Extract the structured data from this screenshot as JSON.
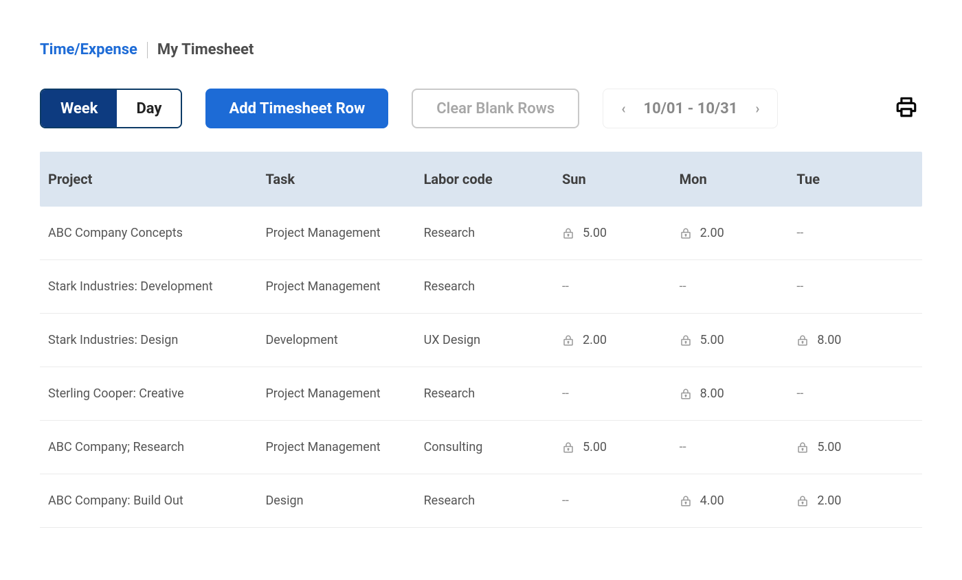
{
  "breadcrumb": {
    "section": "Time/Expense",
    "page": "My Timesheet"
  },
  "toolbar": {
    "view_toggle": {
      "week": "Week",
      "day": "Day",
      "active": "week"
    },
    "add_row": "Add Timesheet Row",
    "clear_rows": "Clear Blank Rows",
    "date_range": "10/01 - 10/31"
  },
  "columns": {
    "project": "Project",
    "task": "Task",
    "labor": "Labor code",
    "sun": "Sun",
    "mon": "Mon",
    "tue": "Tue"
  },
  "rows": [
    {
      "project": "ABC Company Concepts",
      "task": "Project Management",
      "labor": "Research",
      "sun": {
        "locked": true,
        "value": "5.00"
      },
      "mon": {
        "locked": true,
        "value": "2.00"
      },
      "tue": {
        "locked": false,
        "value": "--"
      }
    },
    {
      "project": "Stark Industries: Development",
      "task": "Project Management",
      "labor": "Research",
      "sun": {
        "locked": false,
        "value": "--"
      },
      "mon": {
        "locked": false,
        "value": "--"
      },
      "tue": {
        "locked": false,
        "value": "--"
      }
    },
    {
      "project": "Stark Industries: Design",
      "task": "Development",
      "labor": "UX Design",
      "sun": {
        "locked": true,
        "value": "2.00"
      },
      "mon": {
        "locked": true,
        "value": "5.00"
      },
      "tue": {
        "locked": true,
        "value": "8.00"
      }
    },
    {
      "project": "Sterling Cooper: Creative",
      "task": "Project Management",
      "labor": "Research",
      "sun": {
        "locked": false,
        "value": "--"
      },
      "mon": {
        "locked": true,
        "value": "8.00"
      },
      "tue": {
        "locked": false,
        "value": "--"
      }
    },
    {
      "project": "ABC Company; Research",
      "task": "Project Management",
      "labor": "Consulting",
      "sun": {
        "locked": true,
        "value": "5.00"
      },
      "mon": {
        "locked": false,
        "value": "--"
      },
      "tue": {
        "locked": true,
        "value": "5.00"
      }
    },
    {
      "project": "ABC Company:  Build Out",
      "task": "Design",
      "labor": "Research",
      "sun": {
        "locked": false,
        "value": "--"
      },
      "mon": {
        "locked": true,
        "value": "4.00"
      },
      "tue": {
        "locked": true,
        "value": "2.00"
      }
    }
  ]
}
